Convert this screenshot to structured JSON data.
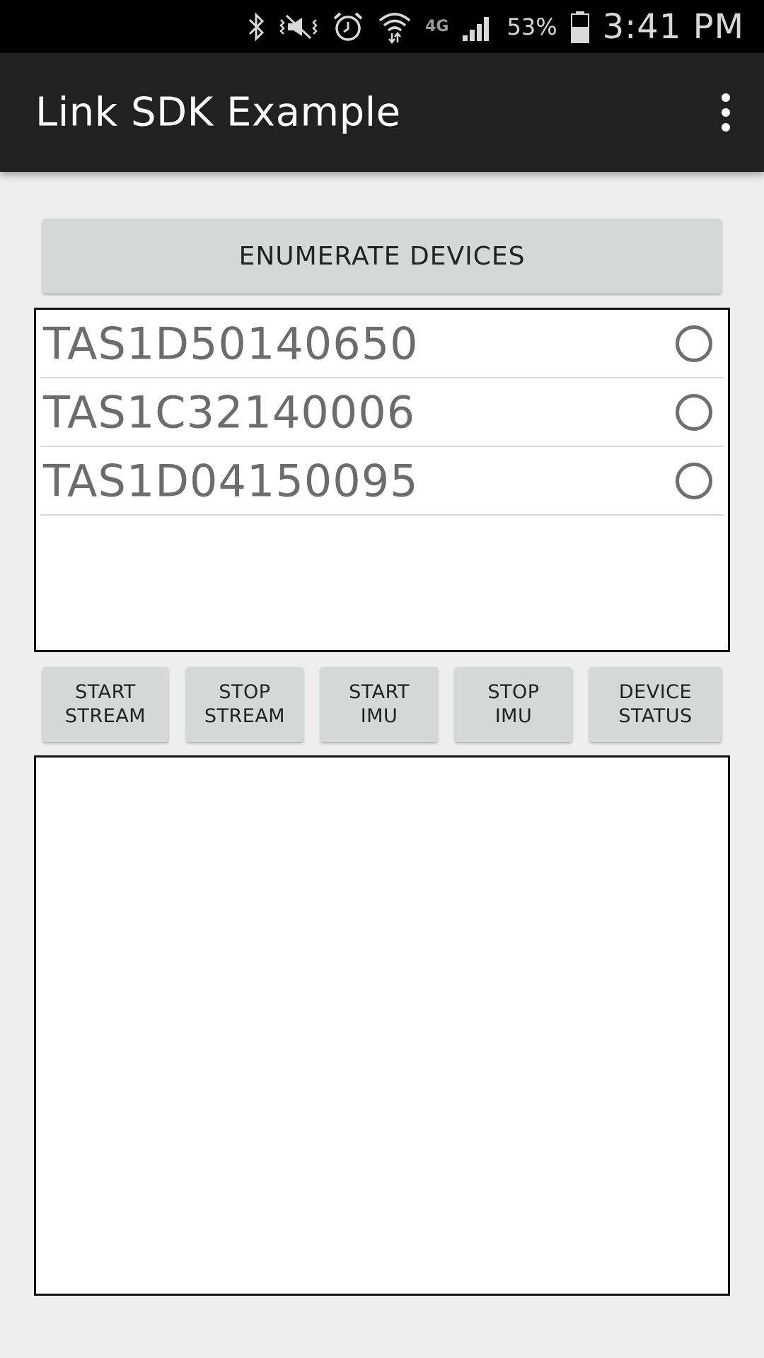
{
  "status_bar": {
    "icons": [
      "bluetooth-icon",
      "vibrate-mute-icon",
      "alarm-icon",
      "wifi-icon",
      "lte-4g-icon",
      "signal-icon",
      "battery-icon"
    ],
    "network_label": "4G",
    "battery_percent": "53%",
    "time": "3:41 PM"
  },
  "app_bar": {
    "title": "Link SDK Example",
    "menu_icon": "overflow-menu-icon"
  },
  "main": {
    "enumerate_label": "ENUMERATE DEVICES",
    "devices": [
      {
        "name": "TAS1D50140650",
        "selected": false
      },
      {
        "name": "TAS1C32140006",
        "selected": false
      },
      {
        "name": "TAS1D04150095",
        "selected": false
      }
    ],
    "actions": [
      {
        "line1": "START",
        "line2": "STREAM"
      },
      {
        "line1": "STOP",
        "line2": "STREAM"
      },
      {
        "line1": "START",
        "line2": "IMU"
      },
      {
        "line1": "STOP",
        "line2": "IMU"
      },
      {
        "line1": "DEVICE",
        "line2": "STATUS"
      }
    ],
    "output_text": ""
  },
  "colors": {
    "status_bar_bg": "#000000",
    "app_bar_bg": "#212121",
    "screen_bg": "#eeeeee",
    "button_bg": "#d6d7d7",
    "device_text": "#6c6c6c"
  }
}
